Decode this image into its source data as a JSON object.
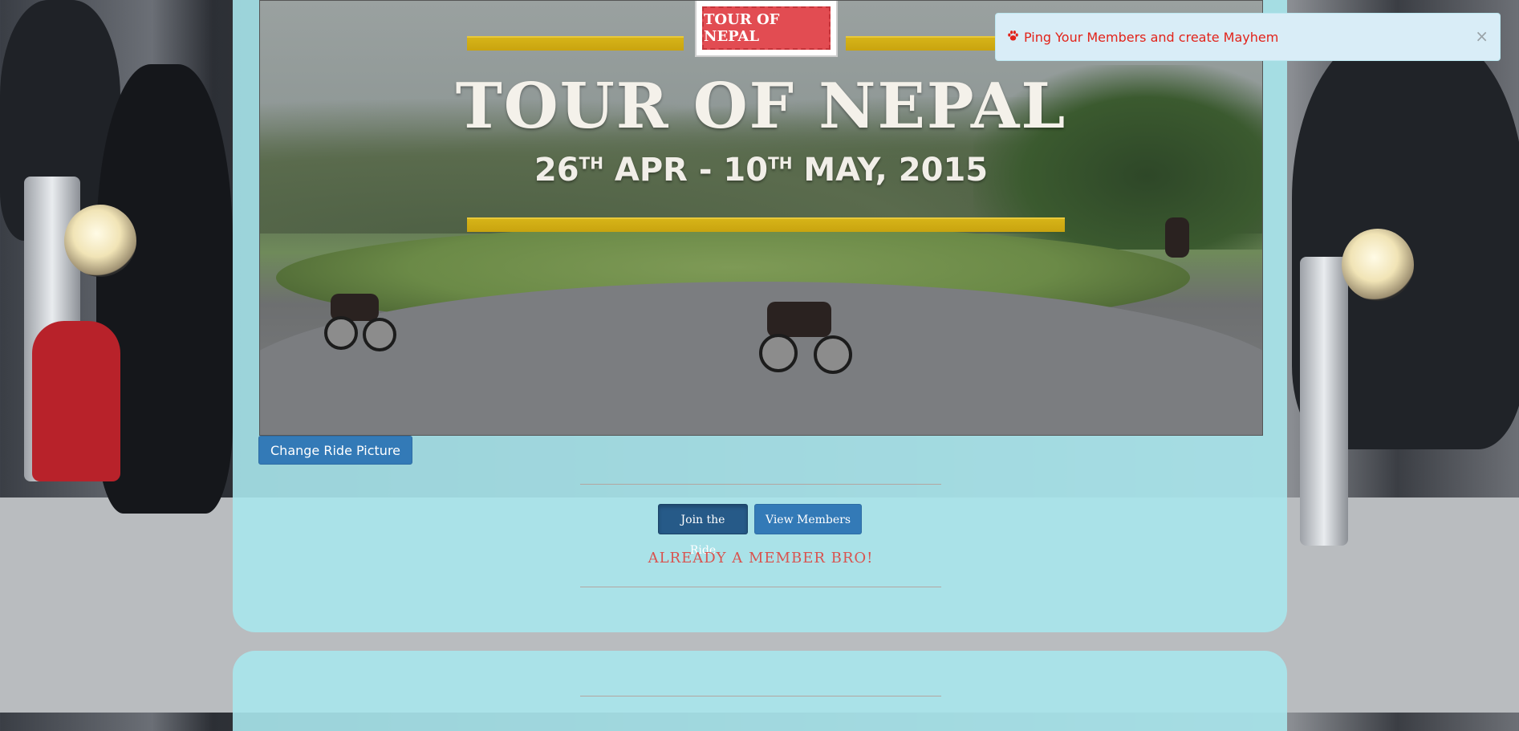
{
  "hero": {
    "stamp_text": "TOUR OF NEPAL",
    "title": "TOUR OF NEPAL",
    "date_day1": "26",
    "date_sup1": "TH",
    "date_mid": " APR - 10",
    "date_sup2": "TH",
    "date_end": " MAY, 2015"
  },
  "actions": {
    "change_picture_label": "Change Ride Picture",
    "join_label": "Join the Ride",
    "view_members_label": "View Members",
    "member_status": "ALREADY A MEMBER BRO!"
  },
  "notification": {
    "icon": "paw-icon",
    "message": "Ping Your Members and create Mayhem",
    "close_label": "×"
  },
  "colors": {
    "panel": "#a8e6ec",
    "primary_button": "#337ab7",
    "active_button": "#265a88",
    "member_text": "#d9534f",
    "toast_bg": "#d9edf7",
    "toast_text": "#e2231a"
  }
}
